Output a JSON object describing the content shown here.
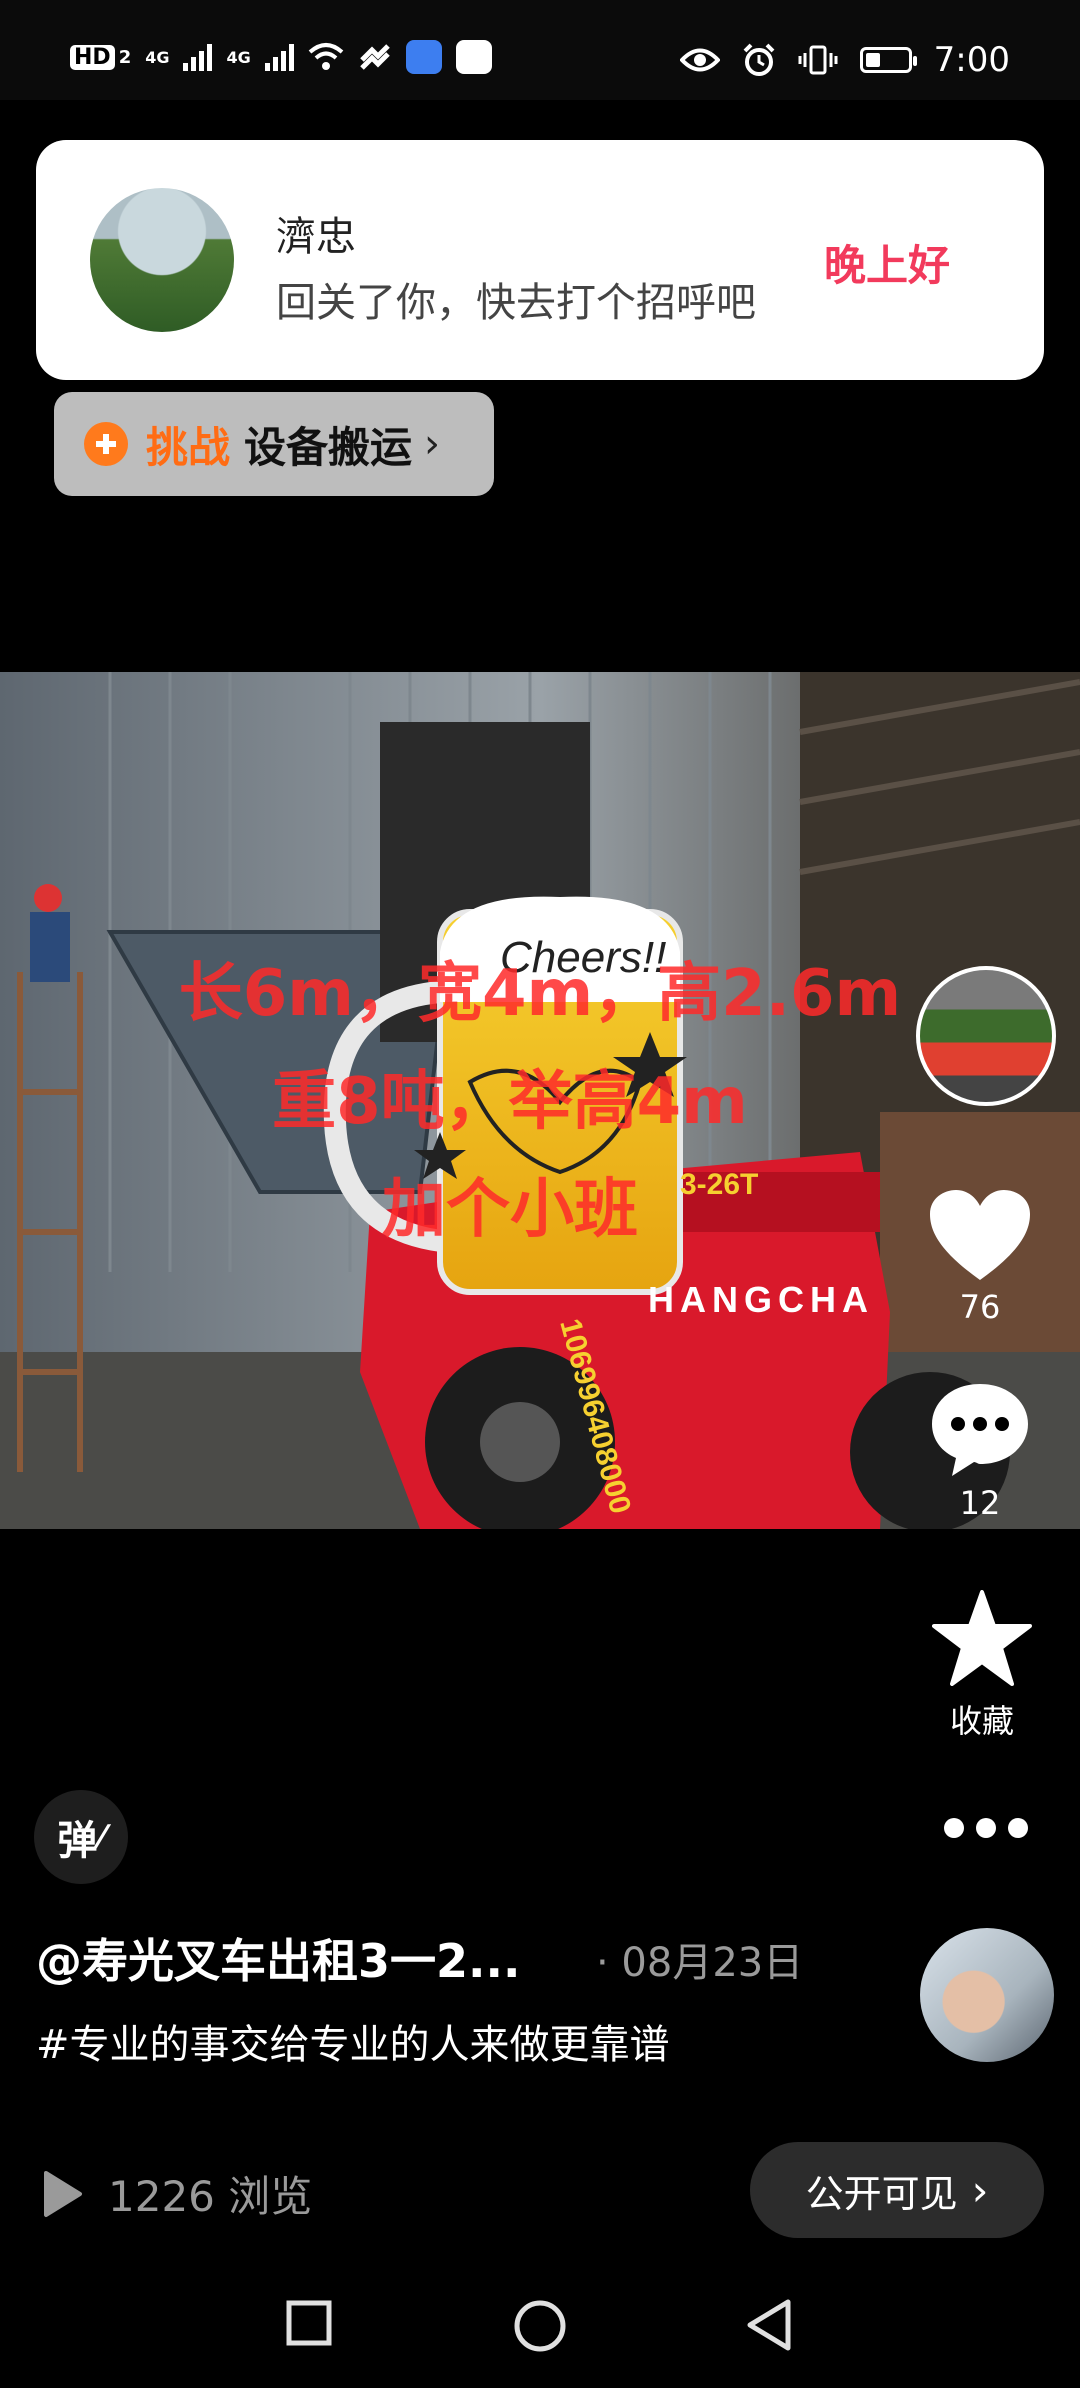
{
  "status_bar": {
    "hd_label": "HD",
    "sim1_label": "2",
    "net1": "4G",
    "net2": "4G",
    "time": "7:00"
  },
  "notification": {
    "name": "濟忠",
    "message": "回关了你，快去打个招呼吧",
    "greeting": "晚上好"
  },
  "challenge": {
    "label": "挑战",
    "topic": "设备搬运"
  },
  "photo_overlay": {
    "line1": "长6m，宽4m，高2.6m",
    "line2": "重8吨，举高4m",
    "line3": "加个小班",
    "mug_text": "Cheers!!",
    "truck_brand": "HANGCHA",
    "truck_model": "3-26T",
    "truck_phone": "106996408000"
  },
  "actions": {
    "likes": "76",
    "comments": "12",
    "favorite_label": "收藏"
  },
  "danmaku_label": "弹",
  "post": {
    "author": "@寿光叉车出租3一2...",
    "date": "· 08月23日",
    "description": "#专业的事交给专业的人来做更靠谱",
    "views": "1226 浏览",
    "visibility": "公开可见"
  },
  "colors": {
    "greeting": "#f23a5c",
    "challenge_accent": "#ff6c14",
    "overlay_text": "#ff2a2a"
  }
}
